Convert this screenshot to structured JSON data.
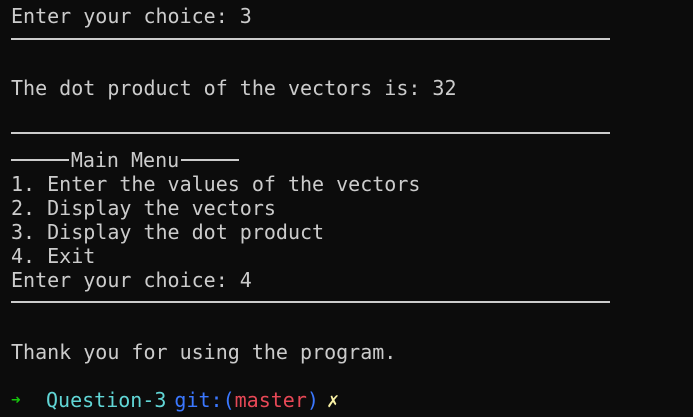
{
  "terminal": {
    "lines": {
      "choice_prev": "Enter your choice: 3",
      "result": "The dot product of the vectors is: 32",
      "menu_title": "Main Menu",
      "item1": "1. Enter the values of the vectors",
      "item2": "2. Display the vectors",
      "item3": "3. Display the dot product",
      "item4": "4. Exit",
      "choice_last": "Enter your choice: 4",
      "goodbye": "Thank you for using the program."
    },
    "prompt": {
      "arrow": "➜",
      "directory": "Question-3",
      "git_label": "git:(",
      "branch": "master",
      "git_close": ")",
      "dirty_mark": "✗"
    },
    "colors": {
      "background": "#0c0c0c",
      "foreground": "#cccccc",
      "arrow": "#16c60c",
      "directory": "#61d6d6",
      "git": "#3b78ff",
      "branch": "#e74856",
      "dirty": "#f9f1a5"
    }
  }
}
